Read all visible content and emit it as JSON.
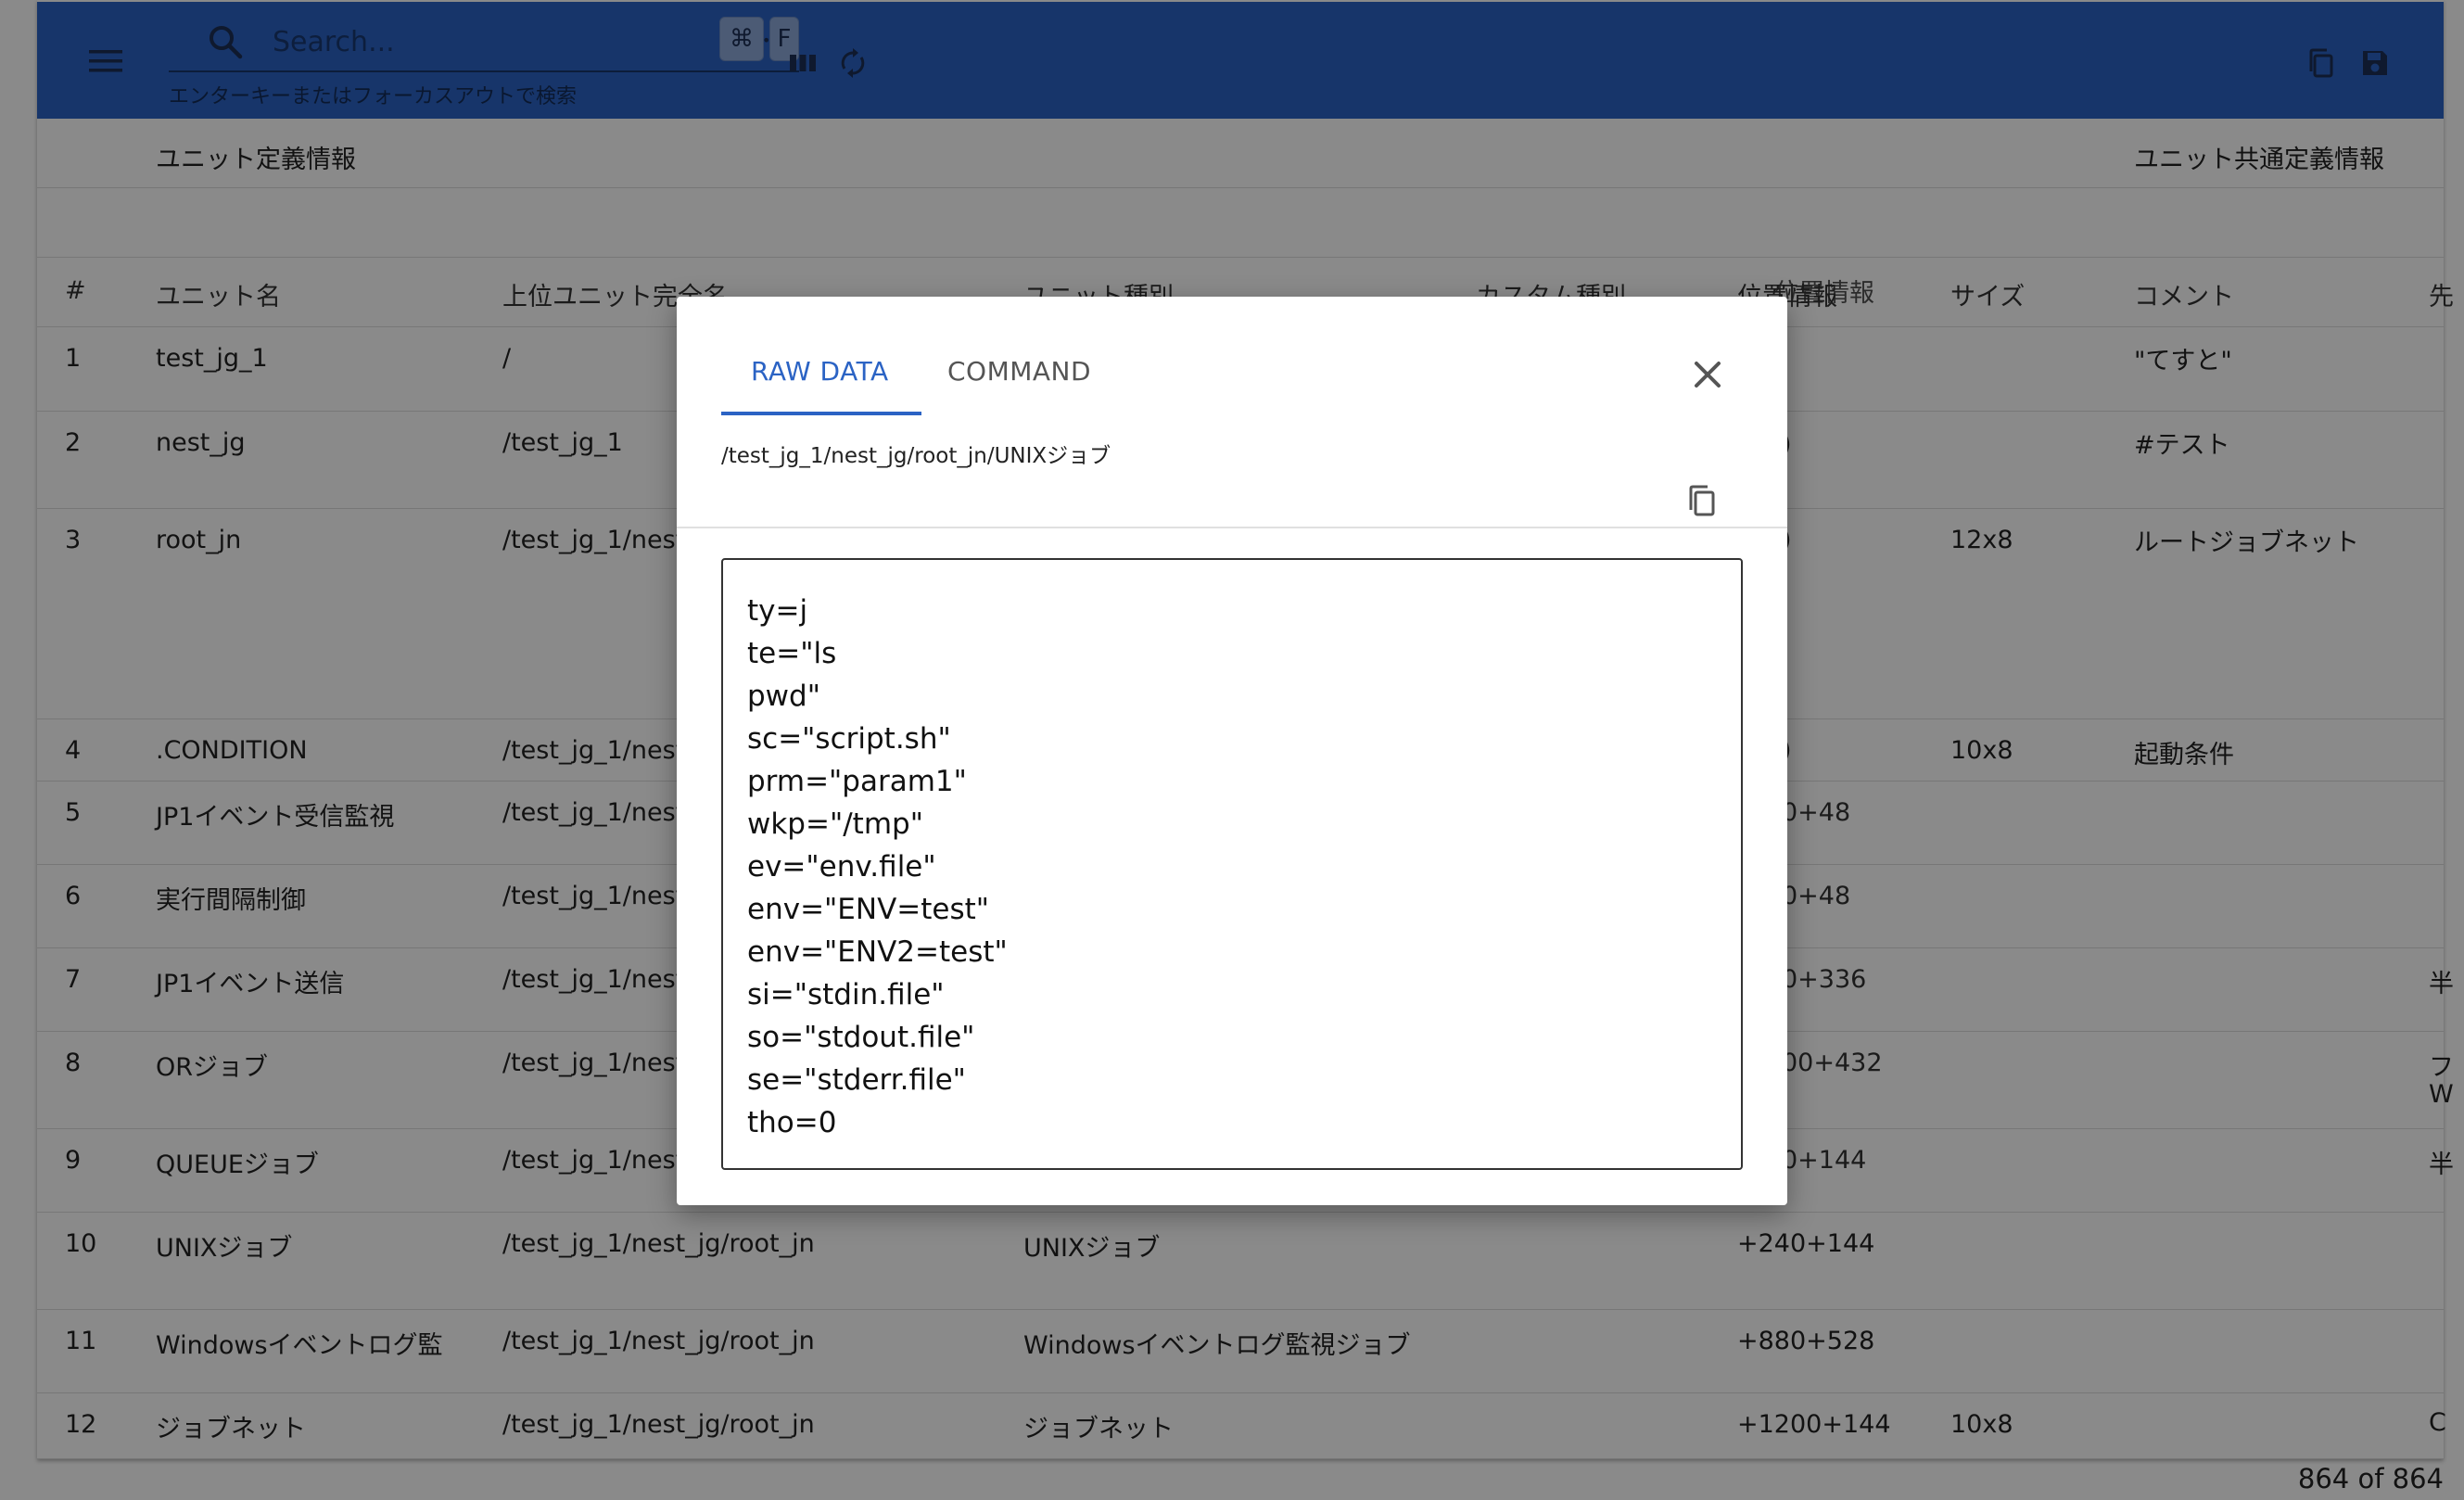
{
  "search": {
    "placeholder": "Search...",
    "shortcut_cmd": "⌘",
    "shortcut_key": "F",
    "hint": "エンターキーまたはフォーカスアウトで検索"
  },
  "groups": {
    "unit_definition": "ユニット定義情報",
    "unit_common_definition": "ユニット共通定義情報"
  },
  "columns": [
    "#",
    "ユニット名",
    "上位ユニット完全名",
    "ユニット種別",
    "カスタム種別",
    "位置情報",
    "サイズ",
    "コメント",
    "先"
  ],
  "rows": [
    {
      "no": "1",
      "name": "test_jg_1",
      "parent": "/",
      "type": "",
      "custom": "",
      "pos": "",
      "size": "",
      "comment": "\"てすと\"",
      "extra": ""
    },
    {
      "no": "2",
      "name": "nest_jg",
      "parent": "/test_jg_1",
      "type": "",
      "custom": "",
      "pos": ")",
      "size": "",
      "comment": "#テスト",
      "extra": ""
    },
    {
      "no": "3",
      "name": "root_jn",
      "parent": "/test_jg_1/nest",
      "type": "",
      "custom": "",
      "pos": ")",
      "size": "12x8",
      "comment": "ルートジョブネット",
      "extra": ""
    },
    {
      "no": "4",
      "name": ".CONDITION",
      "parent": "/test_jg_1/nest",
      "type": "",
      "custom": "",
      "pos": ")",
      "size": "10x8",
      "comment": "起動条件",
      "extra": ""
    },
    {
      "no": "5",
      "name": "JP1イベント受信監視",
      "parent": "/test_jg_1/nest",
      "type": "",
      "custom": "",
      "pos": "0+48",
      "size": "",
      "comment": "",
      "extra": ""
    },
    {
      "no": "6",
      "name": "実行間隔制御",
      "parent": "/test_jg_1/nest",
      "type": "",
      "custom": "",
      "pos": "0+48",
      "size": "",
      "comment": "",
      "extra": ""
    },
    {
      "no": "7",
      "name": "JP1イベント送信",
      "parent": "/test_jg_1/nest",
      "type": "",
      "custom": "",
      "pos": "0+336",
      "size": "",
      "comment": "",
      "extra": "半"
    },
    {
      "no": "8",
      "name": "ORジョブ",
      "parent": "/test_jg_1/nest",
      "type": "",
      "custom": "",
      "pos": "00+432",
      "size": "",
      "comment": "",
      "extra": "フ"
    },
    {
      "no": "9",
      "name": "QUEUEジョブ",
      "parent": "/test_jg_1/nest",
      "type": "",
      "custom": "",
      "pos": "0+144",
      "size": "",
      "comment": "",
      "extra": "半"
    },
    {
      "no": "10",
      "name": "UNIXジョブ",
      "parent": "/test_jg_1/nest_jg/root_jn",
      "type": "UNIXジョブ",
      "custom": "",
      "pos": "+240+144",
      "size": "",
      "comment": "",
      "extra": ""
    },
    {
      "no": "11",
      "name": "Windowsイベントログ監",
      "parent": "/test_jg_1/nest_jg/root_jn",
      "type": "Windowsイベントログ監視ジョブ",
      "custom": "",
      "pos": "+880+528",
      "size": "",
      "comment": "",
      "extra": ""
    },
    {
      "no": "12",
      "name": "ジョブネット",
      "parent": "/test_jg_1/nest_jg/root_jn",
      "type": "ジョブネット",
      "custom": "",
      "pos": "+1200+144",
      "size": "10x8",
      "comment": "",
      "extra": "C"
    }
  ],
  "row8_extra_line2": "W",
  "footer": {
    "count": "864 of 864"
  },
  "dialog": {
    "tabs": [
      "RAW DATA",
      "COMMAND"
    ],
    "active_tab": "RAW DATA",
    "path": "/test_jg_1/nest_jg/root_jn/UNIXジョブ",
    "raw_lines": [
      "ty=j",
      "te=\"ls",
      "pwd\"",
      "sc=\"script.sh\"",
      "prm=\"param1\"",
      "wkp=\"/tmp\"",
      "ev=\"env.file\"",
      "env=\"ENV=test\"",
      "env=\"ENV2=test\"",
      "si=\"stdin.file\"",
      "so=\"stdout.file\"",
      "se=\"stderr.file\"",
      "tho=0"
    ]
  },
  "colors": {
    "toolbar": "#2b63c4",
    "accent": "#2b63c4",
    "overlay": "rgba(0,0,0,0.46)"
  },
  "icons": [
    "menu-icon",
    "search-icon",
    "columns-icon",
    "refresh-icon",
    "copy-icon",
    "save-icon",
    "close-icon"
  ]
}
